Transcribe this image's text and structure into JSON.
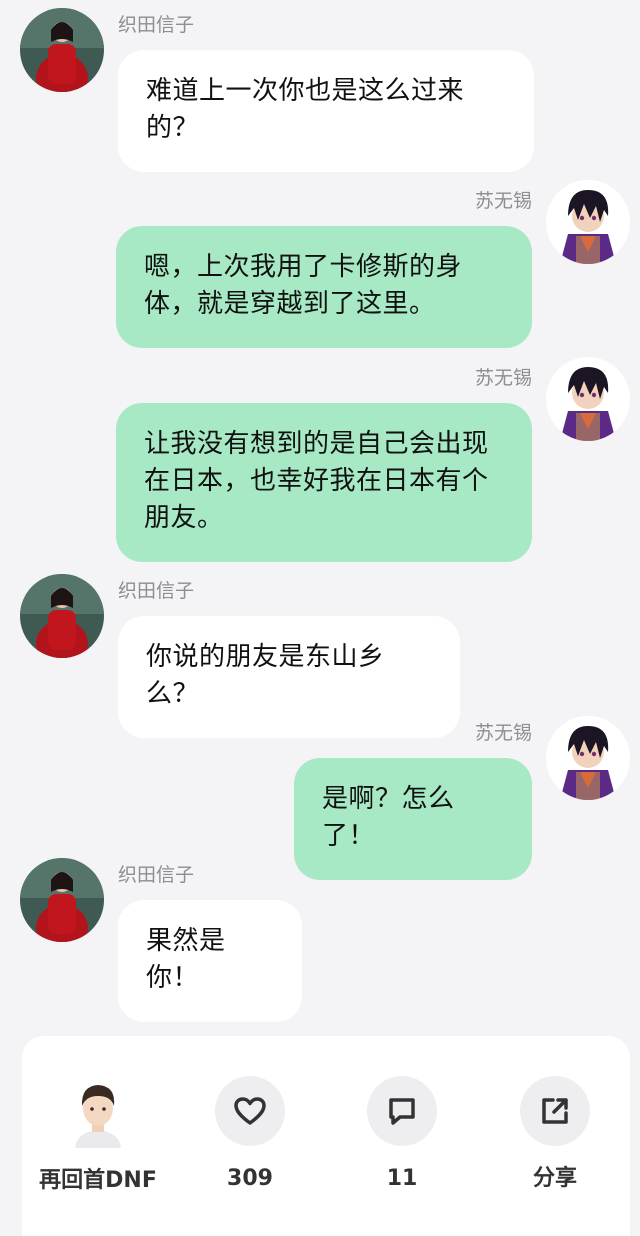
{
  "chat": {
    "messages": [
      {
        "side": "left",
        "sender": "织田信子",
        "text": "难道上一次你也是这么过来的？",
        "avatar": "woman-in-red-avatar"
      },
      {
        "side": "right",
        "sender": "苏无锡",
        "text": "嗯，上次我用了卡修斯的身体，就是穿越到了这里。",
        "avatar": "anime-boy-avatar"
      },
      {
        "side": "right",
        "sender": "苏无锡",
        "text": "让我没有想到的是自己会出现在日本，也幸好我在日本有个朋友。",
        "avatar": "anime-boy-avatar"
      },
      {
        "side": "left",
        "sender": "织田信子",
        "text": "你说的朋友是东山乡么？",
        "avatar": "woman-in-red-avatar"
      },
      {
        "side": "right",
        "sender": "苏无锡",
        "text": "是啊？怎么了！",
        "avatar": "anime-boy-avatar"
      },
      {
        "side": "left",
        "sender": "织田信子",
        "text": "果然是你！",
        "avatar": "woman-in-red-avatar"
      }
    ]
  },
  "footer": {
    "author_name": "再回首DNF",
    "likes": "309",
    "comments": "11",
    "share_label": "分享",
    "icons": {
      "like": "heart-icon",
      "comment": "comment-icon",
      "share": "share-icon"
    }
  },
  "colors": {
    "background": "#f4f4f7",
    "right_bubble": "#a6e9c4",
    "left_bubble": "#ffffff",
    "name": "#8d8d92"
  }
}
